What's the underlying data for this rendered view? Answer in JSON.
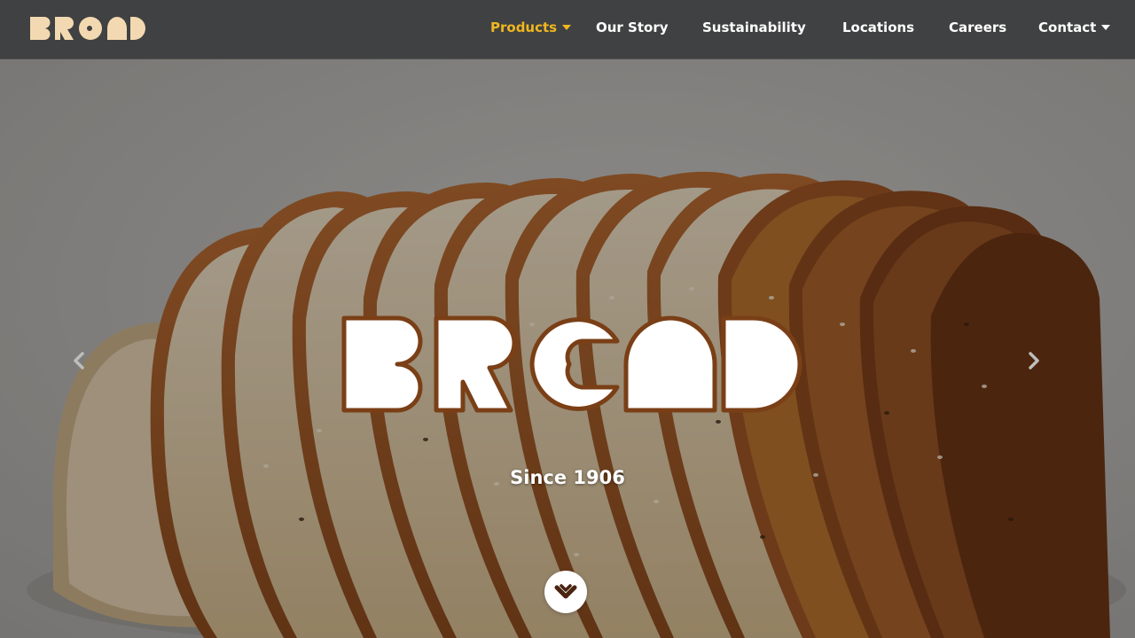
{
  "brand": {
    "name": "BREAD",
    "logo_icon": "brand-wordmark-icon"
  },
  "colors": {
    "nav_background": "#404142",
    "nav_text": "#ffffff",
    "nav_active": "#f0b71f",
    "logo_cream": "#f3d9b1",
    "logo_outline": "#7a3f16",
    "hero_text": "#ffffff"
  },
  "nav": {
    "items": [
      {
        "label": "Products",
        "active": true,
        "has_dropdown": true
      },
      {
        "label": "Our Story",
        "active": false,
        "has_dropdown": false
      },
      {
        "label": "Sustainability",
        "active": false,
        "has_dropdown": false
      },
      {
        "label": "Locations",
        "active": false,
        "has_dropdown": false
      },
      {
        "label": "Careers",
        "active": false,
        "has_dropdown": false
      },
      {
        "label": "Contact",
        "active": false,
        "has_dropdown": true
      }
    ]
  },
  "hero": {
    "tagline": "Since 1906",
    "prev_icon": "chevron-left-icon",
    "next_icon": "chevron-right-icon",
    "scroll_icon": "chevron-down-icon"
  }
}
